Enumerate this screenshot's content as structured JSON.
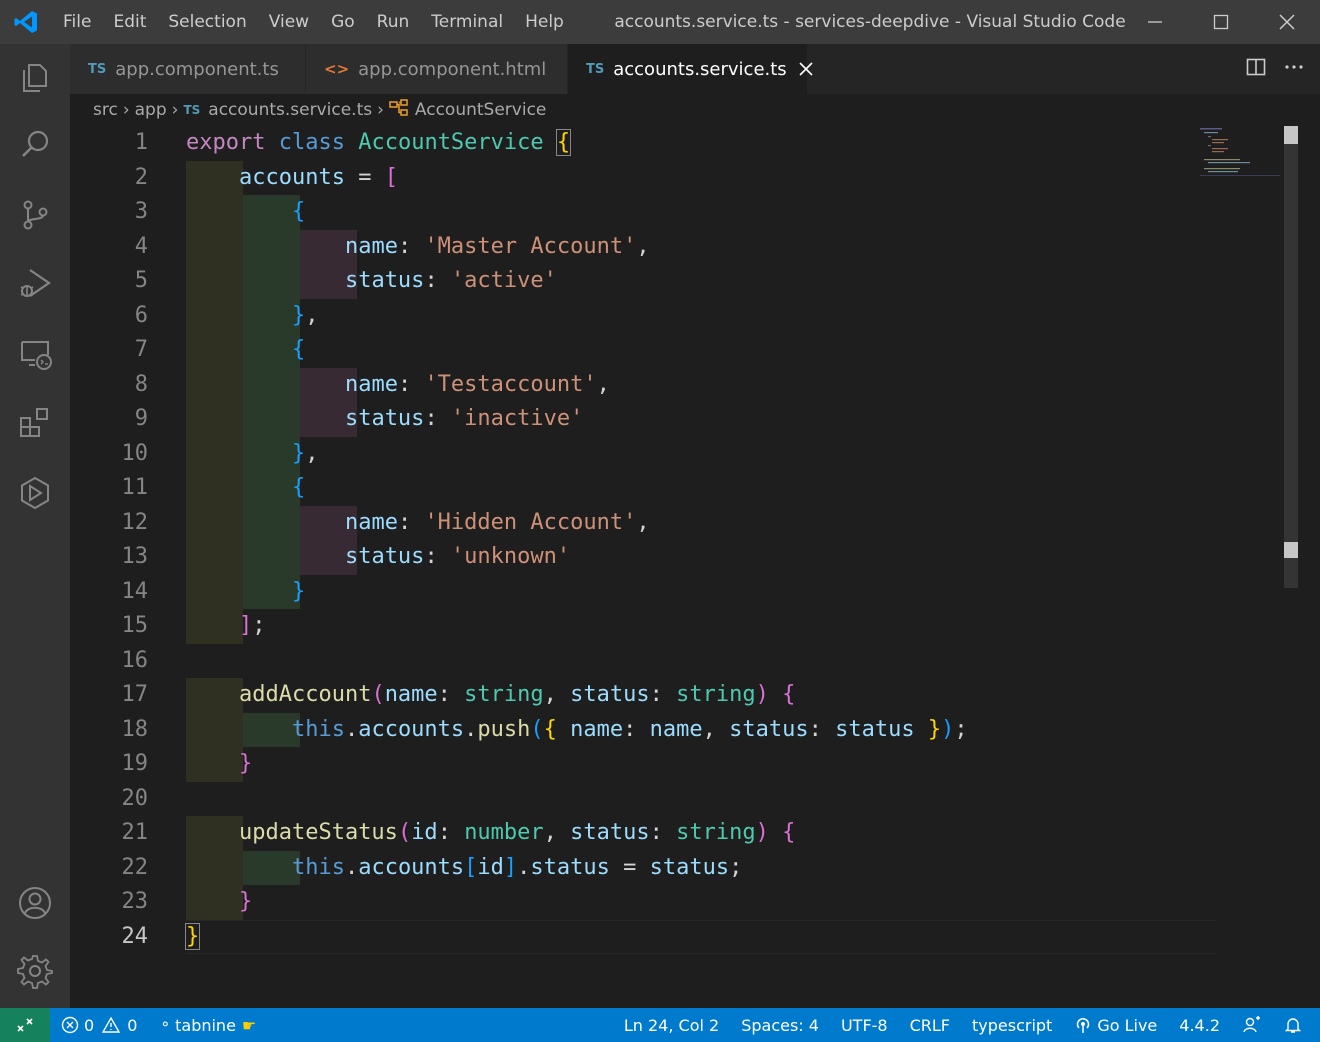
{
  "window": {
    "title": "accounts.service.ts - services-deepdive - Visual Studio Code",
    "menu": [
      "File",
      "Edit",
      "Selection",
      "View",
      "Go",
      "Run",
      "Terminal",
      "Help"
    ]
  },
  "activity_bar": {
    "items": [
      "files-icon",
      "search-icon",
      "source-control-icon",
      "run-debug-icon",
      "remote-explorer-icon",
      "extensions-icon",
      "live-share-icon"
    ],
    "bottom": [
      "accounts-icon",
      "settings-gear-icon"
    ]
  },
  "tabs": [
    {
      "badge": "TS",
      "label": "app.component.ts",
      "active": false
    },
    {
      "badge": "<>",
      "label": "app.component.html",
      "active": false
    },
    {
      "badge": "TS",
      "label": "accounts.service.ts",
      "active": true
    }
  ],
  "breadcrumb": {
    "parts": [
      "src",
      "app",
      "accounts.service.ts",
      "AccountService"
    ],
    "ts_badge": "TS"
  },
  "editor": {
    "line_numbers": [
      "1",
      "2",
      "3",
      "4",
      "5",
      "6",
      "7",
      "8",
      "9",
      "10",
      "11",
      "12",
      "13",
      "14",
      "15",
      "16",
      "17",
      "18",
      "19",
      "20",
      "21",
      "22",
      "23",
      "24"
    ],
    "current_line": 24,
    "code": {
      "l1_export": "export",
      "l1_class": "class",
      "l1_name": "AccountService",
      "accounts": "accounts",
      "name_key": "name",
      "status_key": "status",
      "s_master": "'Master Account'",
      "s_active": "'active'",
      "s_test": "'Testaccount'",
      "s_inactive": "'inactive'",
      "s_hidden": "'Hidden Account'",
      "s_unknown": "'unknown'",
      "addAccount": "addAccount",
      "updateStatus": "updateStatus",
      "string": "string",
      "number": "number",
      "this": "this",
      "push": "push",
      "id": "id"
    }
  },
  "status_bar": {
    "errors": "0",
    "warnings": "0",
    "tabnine": "tabnine",
    "position": "Ln 24, Col 2",
    "spaces": "Spaces: 4",
    "encoding": "UTF-8",
    "eol": "CRLF",
    "language": "typescript",
    "go_live": "Go Live",
    "version": "4.4.2"
  },
  "colors": {
    "statusbar_bg": "#007acc",
    "remote_bg": "#16825d",
    "editor_bg": "#1e1e1e",
    "activitybar_bg": "#333333"
  }
}
